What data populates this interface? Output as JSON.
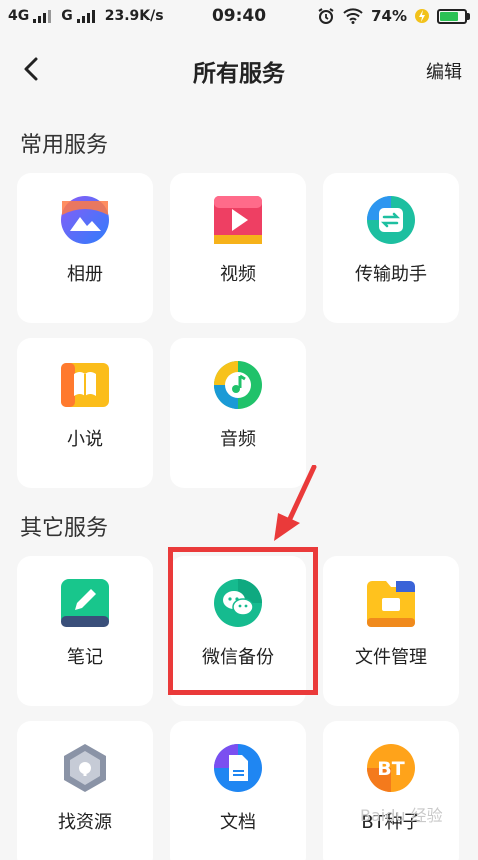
{
  "status": {
    "net1": "4G",
    "net2": "G",
    "speed": "23.9K/s",
    "time": "09:40",
    "battery": "74%"
  },
  "nav": {
    "title": "所有服务",
    "edit_label": "编辑"
  },
  "sections": {
    "common_title": "常用服务",
    "other_title": "其它服务"
  },
  "common_services": [
    {
      "label": "相册",
      "icon": "album-icon"
    },
    {
      "label": "视频",
      "icon": "video-icon"
    },
    {
      "label": "传输助手",
      "icon": "transfer-icon"
    },
    {
      "label": "小说",
      "icon": "novel-icon"
    },
    {
      "label": "音频",
      "icon": "audio-icon"
    }
  ],
  "other_services": [
    {
      "label": "笔记",
      "icon": "notes-icon"
    },
    {
      "label": "微信备份",
      "icon": "wechat-backup-icon"
    },
    {
      "label": "文件管理",
      "icon": "file-manager-icon"
    },
    {
      "label": "找资源",
      "icon": "find-resource-icon"
    },
    {
      "label": "文档",
      "icon": "document-icon"
    },
    {
      "label": "BT种子",
      "icon": "bt-seed-icon"
    }
  ],
  "watermark": "Baidu 经验",
  "colors": {
    "highlight": "#ea3a3a",
    "battery": "#2cc155",
    "background": "#f6f6f6"
  }
}
